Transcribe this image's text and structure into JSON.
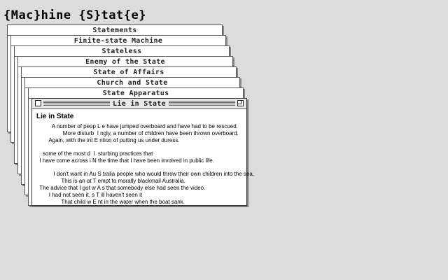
{
  "site_title": "{Mac}hine {S}tat{e}",
  "windows": [
    {
      "title": "Statements"
    },
    {
      "title": "Finite-state Machine"
    },
    {
      "title": "Stateless"
    },
    {
      "title": "Enemy of the State"
    },
    {
      "title": "State of Affairs"
    },
    {
      "title": "Church and State"
    },
    {
      "title": "State Apparatus"
    }
  ],
  "front": {
    "title": "Lie in State",
    "heading": "Lie in State",
    "paragraphs": [
      {
        "lines": [
          "          A number of peop L e have jumped overboard and have had to be rescued.",
          "                 More disturb  I ngly, a number of children have been thrown overboard.",
          "        Again, with the int E ntion of putting us under duress."
        ]
      },
      {
        "lines": [
          "    some of the most d  I  sturbing practices that",
          "  I have come across i N the time that I have been involved in public life."
        ]
      },
      {
        "lines": [
          "           I don't want in Au S tralia people who would throw their own children into the sea.",
          "                This is an at T empt to morally blackmail Australia.",
          "  The advice that I got w A s that somebody else had seen the video.",
          "        I had not seen it, s T ill haven't seen it",
          "                That child w E nt in the water when the boat sank."
        ]
      }
    ]
  }
}
